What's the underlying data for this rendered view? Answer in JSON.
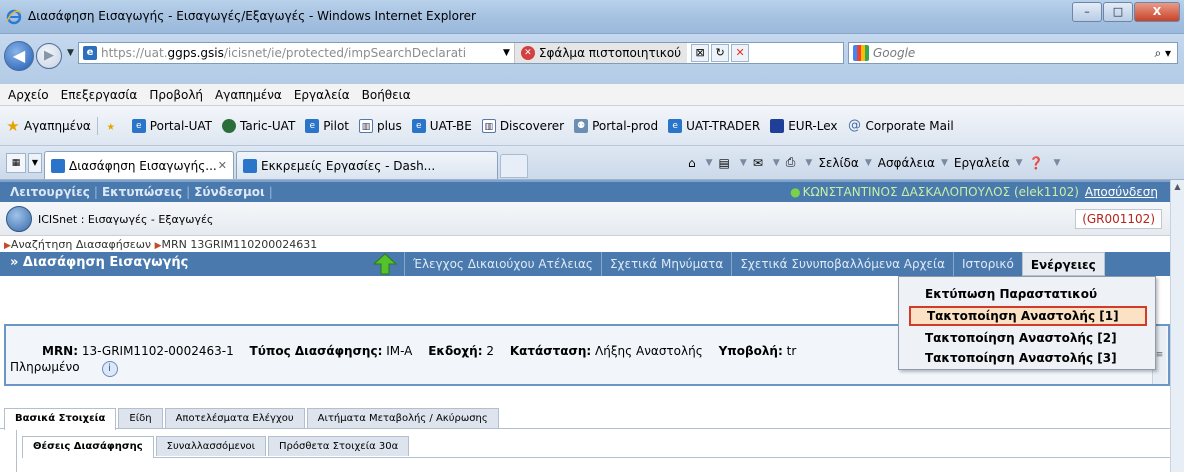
{
  "window": {
    "title": "Διασάφηση Εισαγωγής - Εισαγωγές/Εξαγωγές - Windows Internet Explorer",
    "minimize": "–",
    "maximize": "□",
    "close": "X"
  },
  "address": {
    "url_prefix": "https://uat.",
    "url_host": "ggps.gsis",
    "url_rest": "/icisnet/ie/protected/impSearchDeclarati",
    "cert_error": "Σφάλμα πιστοποιητικού",
    "search_placeholder": "Google"
  },
  "menu": [
    "Αρχείο",
    "Επεξεργασία",
    "Προβολή",
    "Αγαπημένα",
    "Εργαλεία",
    "Βοήθεια"
  ],
  "favorites": {
    "label": "Αγαπημένα",
    "items": [
      {
        "label": "Portal-UAT",
        "icon": "ie-page-icon"
      },
      {
        "label": "Taric-UAT",
        "icon": "globe-icon"
      },
      {
        "label": "Pilot",
        "icon": "ie-page-icon"
      },
      {
        "label": "plus",
        "icon": "chart-icon"
      },
      {
        "label": "UAT-BE",
        "icon": "ie-page-icon"
      },
      {
        "label": "Discoverer",
        "icon": "chart-icon"
      },
      {
        "label": "Portal-prod",
        "icon": "group-icon"
      },
      {
        "label": "UAT-TRADER",
        "icon": "ie-page-icon"
      },
      {
        "label": "EUR-Lex",
        "icon": "monitor-icon"
      },
      {
        "label": "Corporate Mail",
        "icon": "mail-icon"
      }
    ]
  },
  "tabs": {
    "active": "Διασάφηση Εισαγωγής...",
    "inactive": "Εκκρεμείς Εργασίες - Dash..."
  },
  "commandbar": {
    "page": "Σελίδα",
    "safety": "Ασφάλεια",
    "tools": "Εργαλεία"
  },
  "app": {
    "nav": {
      "functions": "Λειτουργίες",
      "prints": "Εκτυπώσεις",
      "links": "Σύνδεσμοι",
      "user": "ΚΩΝΣΤΑΝΤΙΝΟΣ ΔΑΣΚΑΛΟΠΟΥΛΟΣ (elek1102)",
      "logout": "Αποσύνδεση"
    },
    "header": {
      "name": "ICISnet : Εισαγωγές - Εξαγωγές",
      "office_code": "(GR001102)"
    },
    "breadcrumb": {
      "item1": "Αναζήτηση Διασαφήσεων",
      "item2": "MRN 13GRIM110200024631"
    },
    "section": {
      "title": "» Διασάφηση Εισαγωγής",
      "tabs": [
        "Έλεγχος Δικαιούχου Ατέλειας",
        "Σχετικά Μηνύματα",
        "Σχετικά Συνυποβαλλόμενα Αρχεία",
        "Ιστορικό"
      ],
      "actions": "Ενέργειες"
    },
    "actions_menu": [
      "Εκτύπωση Παραστατικού",
      "Τακτοποίηση Αναστολής [1]",
      "Τακτοποίηση Αναστολής [2]",
      "Τακτοποίηση Αναστολής [3]"
    ],
    "summary": {
      "mrn_label": "MRN:",
      "mrn_value": "13-GRIM1102-0002463-1",
      "type_label": "Τύπος Διασάφησης:",
      "type_value": "IM-A",
      "version_label": "Εκδοχή:",
      "version_value": "2",
      "status_label": "Κατάσταση:",
      "status_value": "Λήξης Αναστολής",
      "submit_label": "Υποβολή:",
      "submit_value": "tr",
      "payment": "Πληρωμένο"
    },
    "main_tabs": [
      "Βασικά Στοιχεία",
      "Είδη",
      "Αποτελέσματα Ελέγχου",
      "Αιτήματα Μεταβολής / Ακύρωσης"
    ],
    "sub_tabs": [
      "Θέσεις Διασάφησης",
      "Συναλλασσόμενοι",
      "Πρόσθετα Στοιχεία 30α"
    ]
  }
}
